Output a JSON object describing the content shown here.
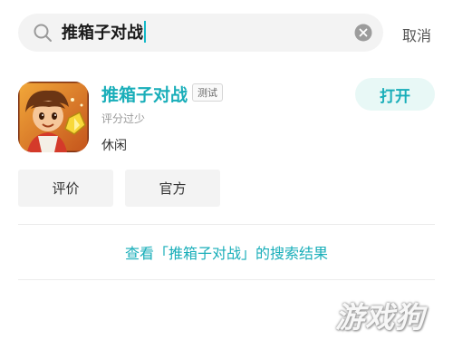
{
  "search": {
    "query": "推箱子对战",
    "cancel_label": "取消"
  },
  "app": {
    "name": "推箱子对战",
    "tag": "测试",
    "rating": "评分过少",
    "category": "休闲",
    "open_label": "打开"
  },
  "actions": {
    "review_label": "评价",
    "official_label": "官方"
  },
  "results_link": "查看「推箱子对战」的搜索结果",
  "watermark": "游戏狗",
  "colors": {
    "accent": "#19aeb9",
    "open_button_bg": "#e8f8f6",
    "input_bg": "#f3f3f3"
  }
}
